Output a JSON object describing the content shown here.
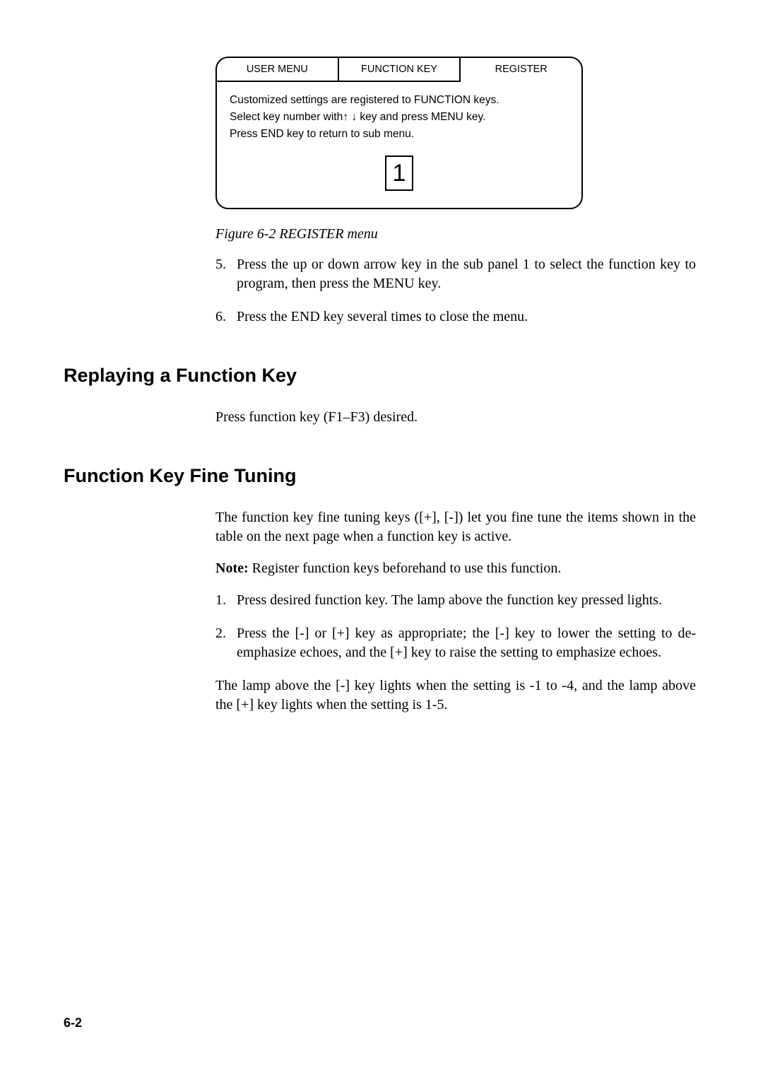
{
  "menu": {
    "tabs": [
      "USER MENU",
      "FUNCTION  KEY",
      "REGISTER"
    ],
    "body_line1": "Customized settings are registered to FUNCTION keys.",
    "body_line2_pre": "Select key number with",
    "body_line2_post": " key and press MENU key.",
    "body_line3": "Press END key to return to sub menu.",
    "selected_number": "1"
  },
  "fig_caption": "Figure 6-2 REGISTER menu",
  "ol_top": {
    "item5": "Press the up or down arrow key in the sub panel 1 to select the function key to program, then press the MENU key.",
    "item6": "Press the END key several times to close the menu."
  },
  "h_replay": "Replaying a Function Key",
  "replay_body": "Press function key (F1–F3) desired.",
  "h_tuning": "Function Key Fine Tuning",
  "tuning": {
    "intro": "The function key fine tuning keys ([+], [-]) let you fine tune the items shown in the table on the next page when a function key is active.",
    "note_label": "Note:",
    "note_text": "  Register function keys beforehand to use this function.",
    "step1": "Press desired function key. The lamp above the function key pressed lights.",
    "step2": "Press the [-] or [+] key as appropriate; the [-] key to lower the setting to de-emphasize echoes, and the [+] key to raise the setting to emphasize echoes.",
    "outro": "The lamp above the [-] key lights when the setting is -1 to -4, and the lamp above the [+] key lights when the setting is 1-5."
  },
  "page_number": "6-2"
}
